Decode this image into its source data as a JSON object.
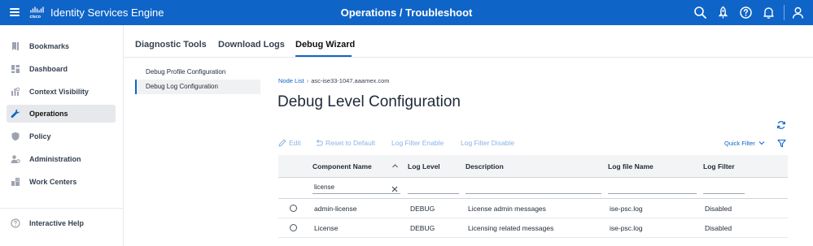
{
  "header": {
    "logo_text": "cisco",
    "app_title": "Identity Services Engine",
    "page_title": "Operations / Troubleshoot",
    "icons": [
      "search-icon",
      "rocket-icon",
      "help-icon",
      "bell-icon",
      "user-icon"
    ],
    "brand_color": "#0f64c8"
  },
  "sidebar": {
    "items": [
      {
        "label": "Bookmarks",
        "icon": "bookmark-icon"
      },
      {
        "label": "Dashboard",
        "icon": "dashboard-icon"
      },
      {
        "label": "Context Visibility",
        "icon": "context-visibility-icon"
      },
      {
        "label": "Operations",
        "icon": "wrench-icon",
        "active": true
      },
      {
        "label": "Policy",
        "icon": "shield-icon"
      },
      {
        "label": "Administration",
        "icon": "admin-icon"
      },
      {
        "label": "Work Centers",
        "icon": "work-centers-icon"
      }
    ],
    "help_label": "Interactive Help"
  },
  "tabs": [
    {
      "label": "Diagnostic Tools"
    },
    {
      "label": "Download Logs"
    },
    {
      "label": "Debug Wizard",
      "active": true
    }
  ],
  "subnav": [
    {
      "label": "Debug Profile Configuration"
    },
    {
      "label": "Debug Log Configuration",
      "active": true
    }
  ],
  "breadcrumb": {
    "link": "Node List",
    "current": "asc-ise33-1047.aaamex.com"
  },
  "heading": "Debug Level Configuration",
  "toolbar": {
    "edit": "Edit",
    "reset": "Reset to Default",
    "filter_enable": "Log Filter Enable",
    "filter_disable": "Log Filter Disable",
    "quick_filter": "Quick Filter"
  },
  "table": {
    "columns": [
      "Component Name",
      "Log Level",
      "Description",
      "Log file Name",
      "Log Filter"
    ],
    "filter_value": "license",
    "rows": [
      {
        "component": "admin-license",
        "level": "DEBUG",
        "description": "License admin messages",
        "file": "ise-psc.log",
        "filter": "Disabled"
      },
      {
        "component": "License",
        "level": "DEBUG",
        "description": "Licensing related messages",
        "file": "ise-psc.log",
        "filter": "Disabled"
      }
    ]
  }
}
